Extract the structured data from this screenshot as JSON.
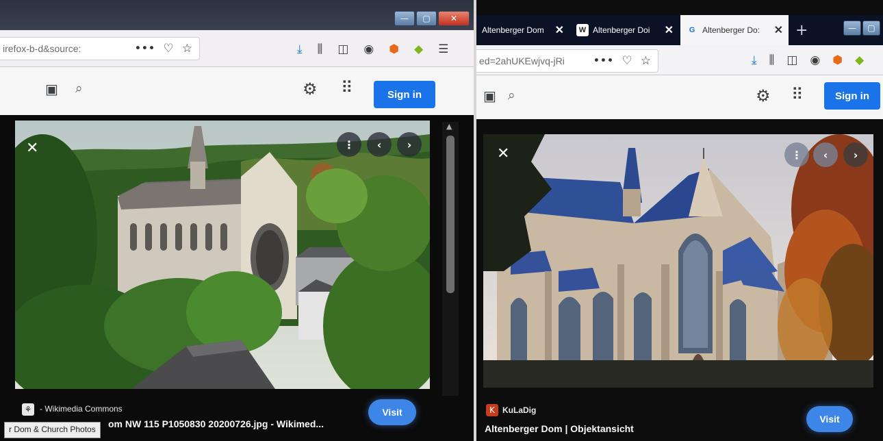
{
  "left_window": {
    "url_text": "irefox-b-d&source:",
    "url_more": "•••",
    "caption": {
      "source": "- Wikimedia Commons",
      "title": "om NW 115 P1050830 20200726.jpg - Wikimed...",
      "visit": "Visit"
    },
    "tooltip": "r Dom & Church Photos",
    "signin": "Sign in",
    "window_controls": [
      "—",
      "▢",
      "✕"
    ]
  },
  "right_window": {
    "tabs": [
      {
        "label": "Altenberger Dom",
        "close": "✕"
      },
      {
        "label": "Altenberger Doi",
        "close": "✕",
        "favicon": "W"
      },
      {
        "label": "Altenberger Do:",
        "close": "✕",
        "favicon": "G"
      }
    ],
    "newtab": "+",
    "url_text": "ed=2ahUKEwjvq-jRi",
    "url_more": "•••",
    "signin": "Sign in",
    "caption": {
      "source": "KuLaDig",
      "title": "Altenberger Dom | Objektansicht",
      "visit": "Visit"
    }
  },
  "colors": {
    "signin_blue": "#1a73e8",
    "visit_blue": "#3d86e8",
    "viewer_bg": "#0b0b0b"
  }
}
